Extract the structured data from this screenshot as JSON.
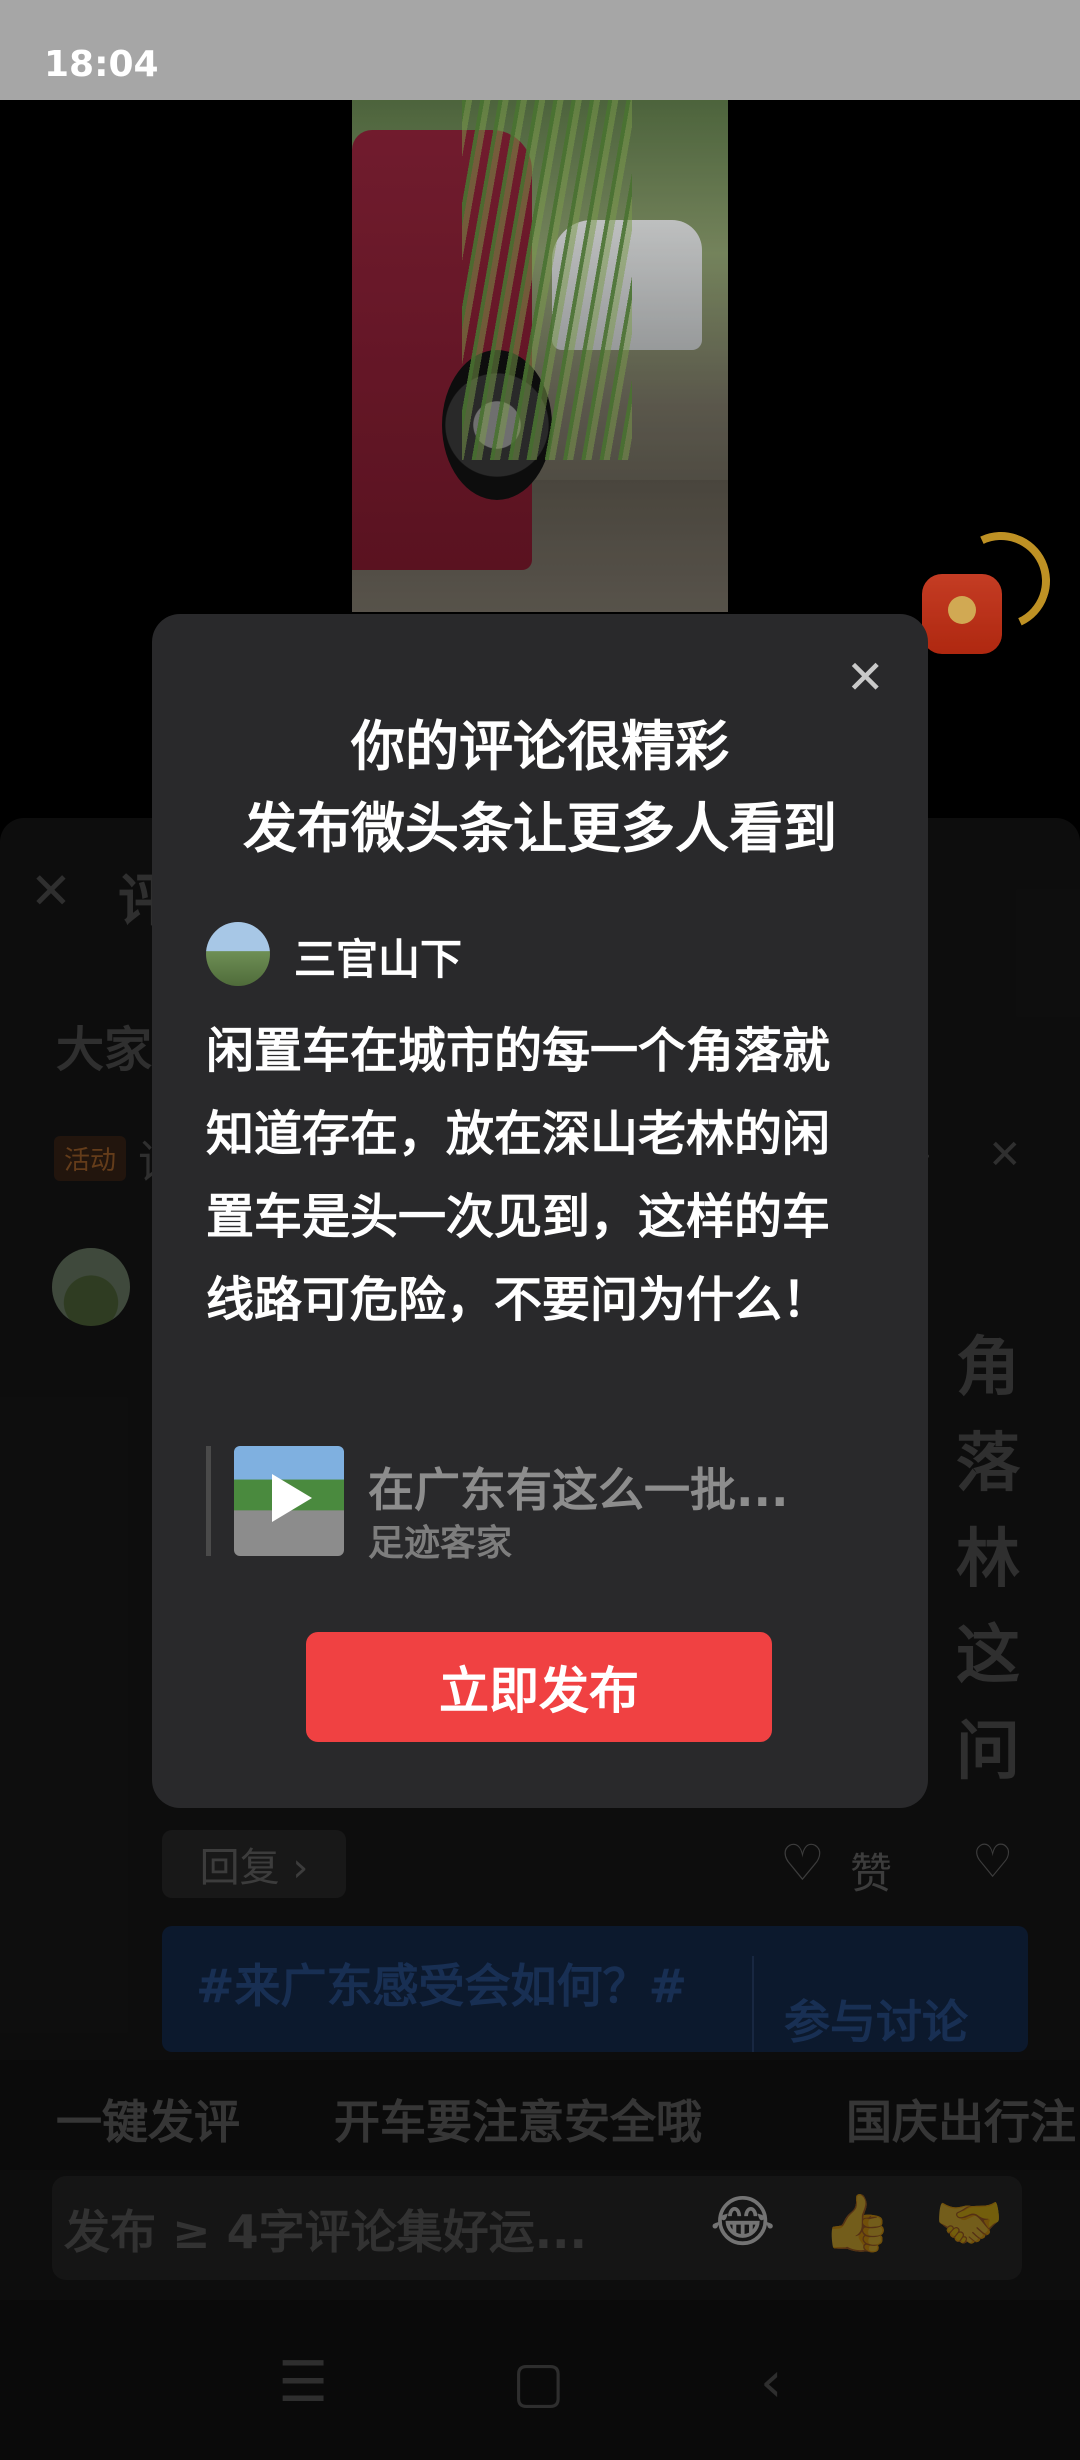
{
  "status_bar": {
    "time": "18:04"
  },
  "video": {
    "description_icon": "video-frame"
  },
  "background_sheet": {
    "close_icon": "✕",
    "title": "评",
    "intro": "大家",
    "activity_badge": "活动",
    "activity_text": "评",
    "activity_arrow": "›",
    "activity_close": "✕",
    "comment_fragments": [
      "角落",
      "林",
      "这",
      "问"
    ],
    "reply_label": "回复 ›",
    "like_label": "赞",
    "topic": "#来广东感受会如何？#",
    "topic_join": "参与讨论",
    "quick_comments": [
      "一键发评",
      "开车要注意安全哦",
      "国庆出行注"
    ],
    "input_placeholder": "发布 ≥ 4字评论集好运...",
    "emojis": [
      "😂",
      "👍",
      "🤝"
    ]
  },
  "dialog": {
    "title_line1": "你的评论很精彩",
    "title_line2": "发布微头条让更多人看到",
    "author": "三官山下",
    "comment": "闲置车在城市的每一个角落就知道存在，放在深山老林的闲置车是头一次见到，这样的车线路可危险，不要问为什么！",
    "quote_title": "在广东有这么一批...",
    "quote_author": "足迹客家",
    "publish_label": "立即发布",
    "accent_color": "#f04142"
  },
  "nav_bar": {
    "menu": "☰",
    "home": "▢",
    "back": "‹"
  }
}
